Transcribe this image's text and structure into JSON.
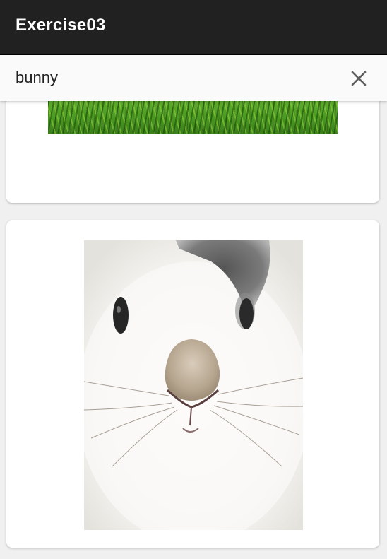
{
  "app_bar": {
    "title": "Exercise03",
    "background": "#212121"
  },
  "search": {
    "value": "bunny",
    "clear_icon": "close-icon"
  },
  "results": {
    "items": [
      {
        "image": "grass-photo"
      },
      {
        "image": "white-bunny-photo"
      }
    ]
  }
}
